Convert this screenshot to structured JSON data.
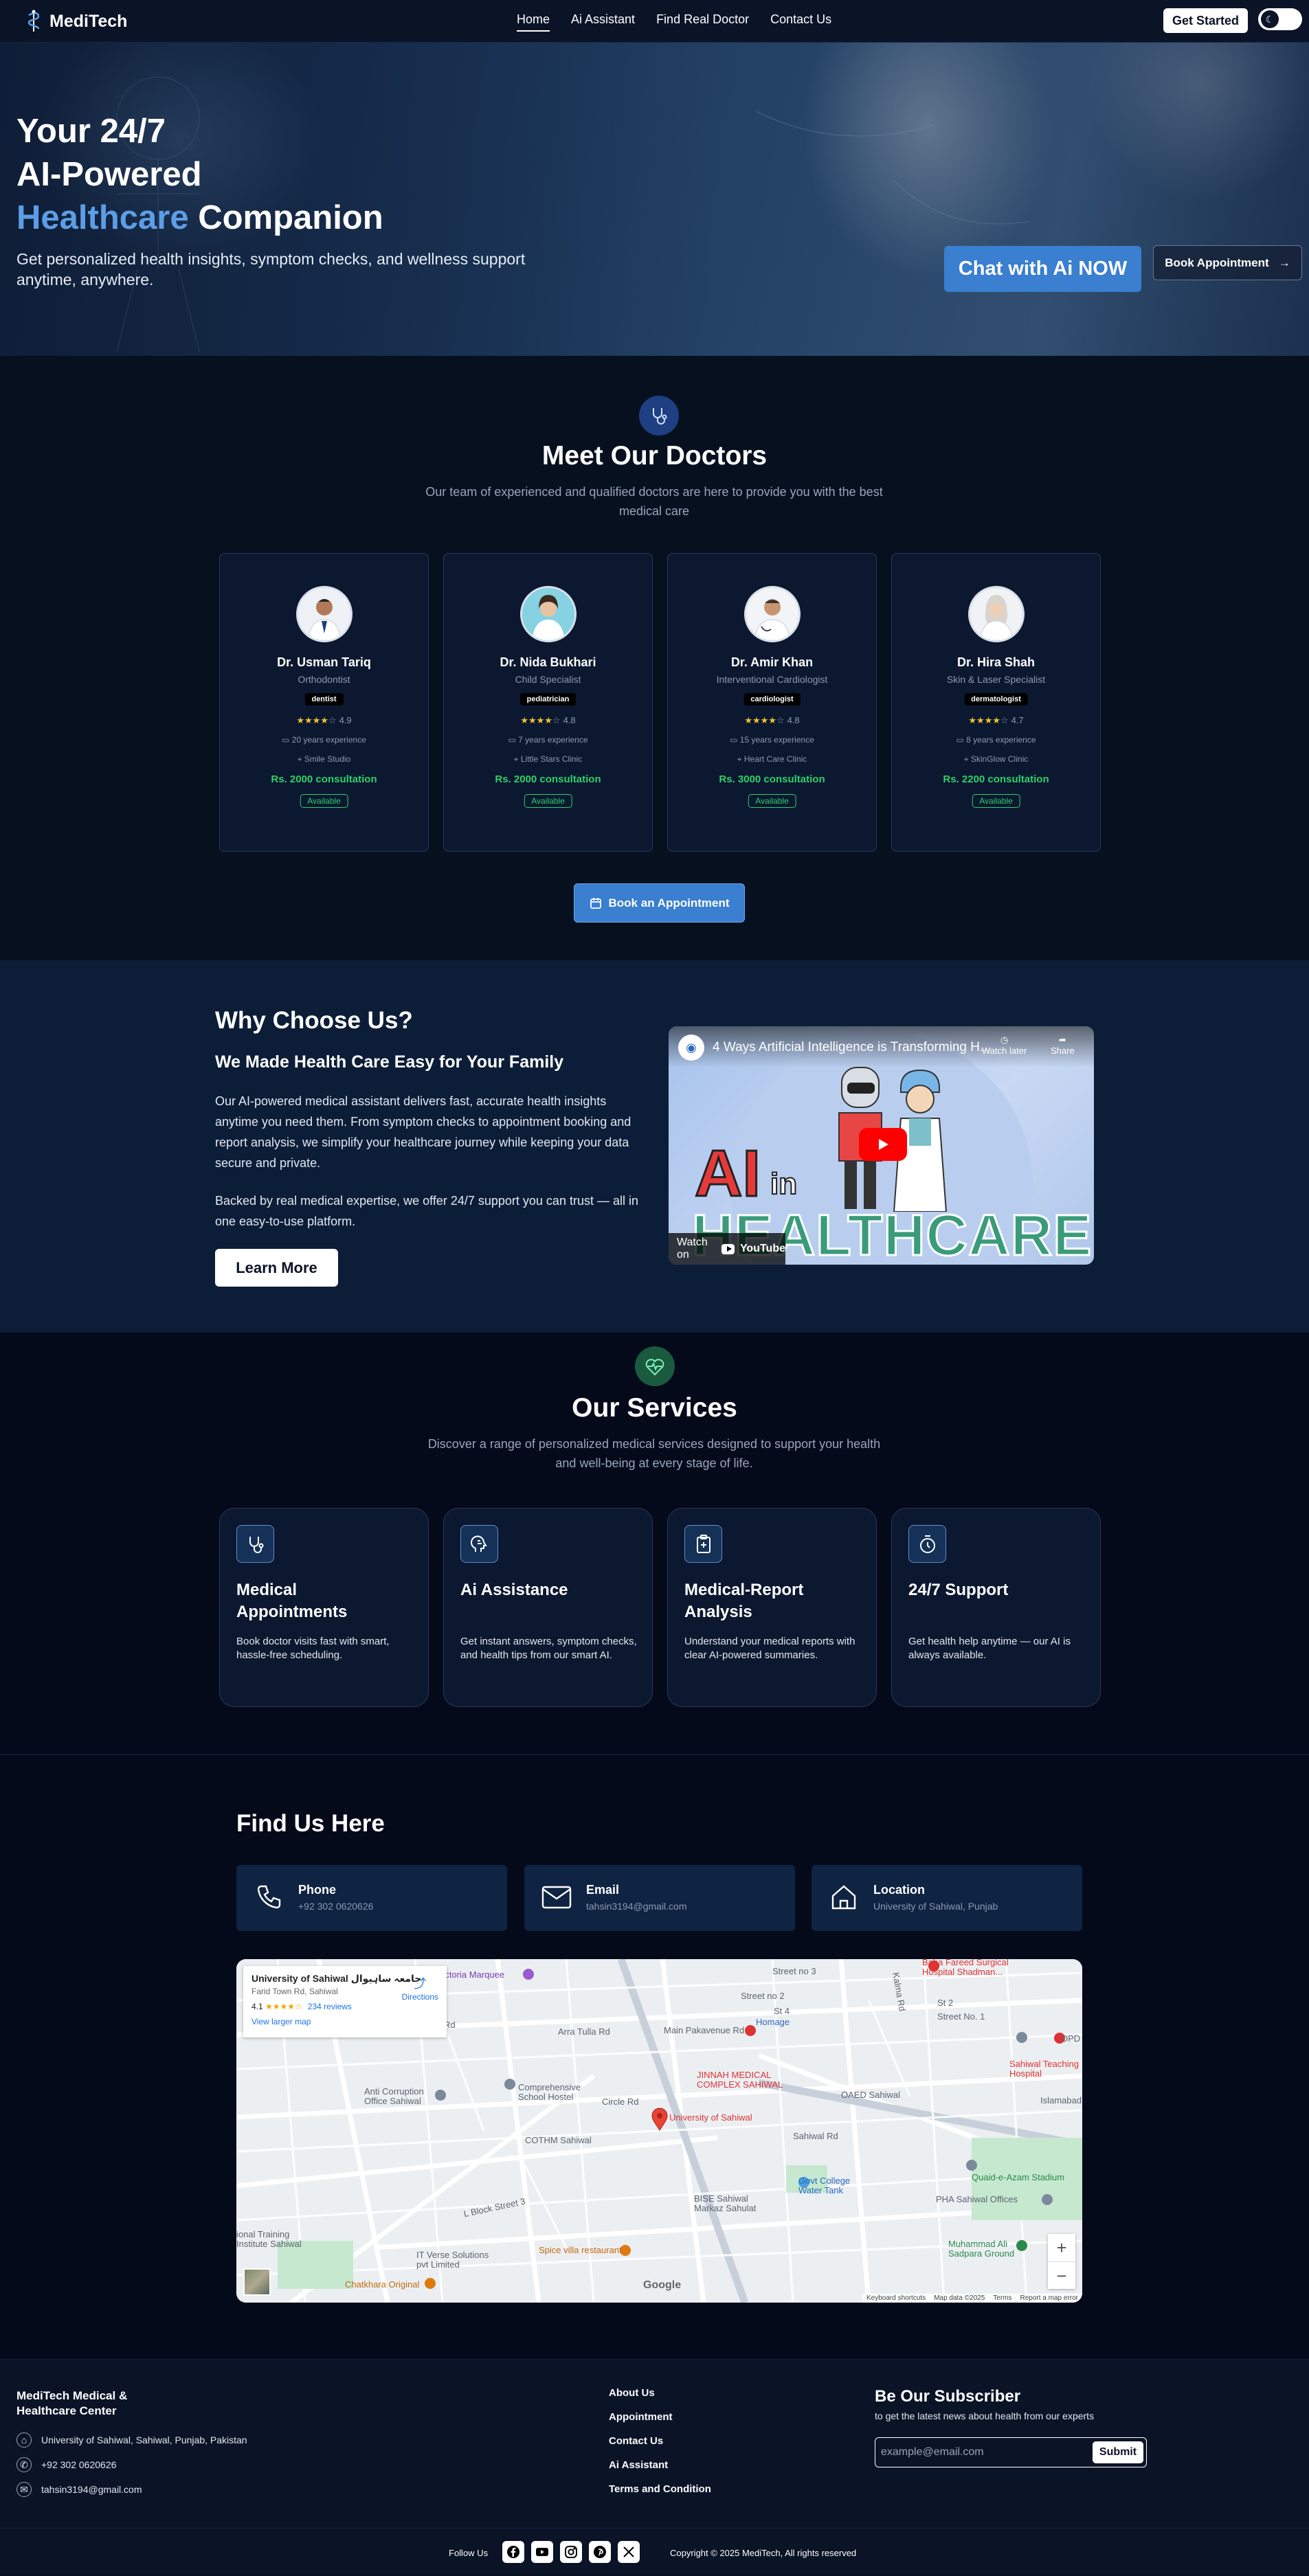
{
  "nav": {
    "brand": "MediTech",
    "links": [
      "Home",
      "Ai Assistant",
      "Find Real Doctor",
      "Contact Us"
    ],
    "get_started": "Get Started",
    "theme_icon": "moon-icon"
  },
  "hero": {
    "title_line1": "Your 24/7",
    "title_line2": "AI-Powered",
    "title_highlight": "Healthcare",
    "title_rest": " Companion",
    "subtitle": "Get personalized health insights, symptom checks, and wellness support anytime, anywhere.",
    "chat_button": "Chat with Ai NOW",
    "book_button": "Book Appointment"
  },
  "doctors": {
    "title": "Meet Our Doctors",
    "description": "Our team of experienced and qualified doctors are here to provide you with the best medical care",
    "icon": "stethoscope-icon",
    "list": [
      {
        "name": "Dr. Usman Tariq",
        "specialty": "Orthodontist",
        "tag": "dentist",
        "rating": "4.9",
        "stars": 4,
        "experience": "20 years experience",
        "clinic": "Smile Studio",
        "fee": "Rs. 2000 consultation",
        "status": "Available"
      },
      {
        "name": "Dr. Nida Bukhari",
        "specialty": "Child Specialist",
        "tag": "pediatrician",
        "rating": "4.8",
        "stars": 4,
        "experience": "7 years experience",
        "clinic": "Little Stars Clinic",
        "fee": "Rs. 2000 consultation",
        "status": "Available"
      },
      {
        "name": "Dr. Amir Khan",
        "specialty": "Interventional Cardiologist",
        "tag": "cardiologist",
        "rating": "4.8",
        "stars": 4,
        "experience": "15 years experience",
        "clinic": "Heart Care Clinic",
        "fee": "Rs. 3000 consultation",
        "status": "Available"
      },
      {
        "name": "Dr. Hira Shah",
        "specialty": "Skin & Laser Specialist",
        "tag": "dermatologist",
        "rating": "4.7",
        "stars": 4,
        "experience": "8 years experience",
        "clinic": "SkinGlow Clinic",
        "fee": "Rs. 2200 consultation",
        "status": "Available"
      }
    ],
    "appointment_button": "Book an Appointment"
  },
  "why": {
    "title": "Why Choose Us?",
    "subtitle": "We Made Health Care Easy for Your Family",
    "p1": "Our AI-powered medical assistant delivers fast, accurate health insights anytime you need them. From symptom checks to appointment booking and report analysis, we simplify your healthcare journey while keeping your data secure and private.",
    "p2": "Backed by real medical expertise, we offer 24/7 support you can trust — all in one easy-to-use platform.",
    "learn_more": "Learn More",
    "video": {
      "title": "4 Ways Artificial Intelligence is Transforming H...",
      "watch_later": "Watch later",
      "share": "Share",
      "watch_on": "Watch on",
      "youtube": "YouTube",
      "thumb_ai": "AI",
      "thumb_in": "in",
      "thumb_hc": "HEALTHCARE"
    }
  },
  "services": {
    "title": "Our Services",
    "description": "Discover a range of personalized medical services designed to support your health and well-being at every stage of life.",
    "icon": "heart-pulse-icon",
    "list": [
      {
        "title": "Medical Appointments",
        "desc": "Book doctor visits fast with smart, hassle-free scheduling.",
        "icon": "stethoscope-icon"
      },
      {
        "title": "Ai Assistance",
        "desc": "Get instant answers, symptom checks, and health tips from our smart AI.",
        "icon": "ai-brain-icon"
      },
      {
        "title": "Medical-Report Analysis",
        "desc": "Understand your medical reports with clear AI-powered summaries.",
        "icon": "clipboard-plus-icon"
      },
      {
        "title": "24/7 Support",
        "desc": "Get health help anytime — our AI is always available.",
        "icon": "clock-icon"
      }
    ]
  },
  "find": {
    "title": "Find Us Here",
    "contacts": [
      {
        "label": "Phone",
        "value": "+92 302 0620626",
        "icon": "phone-icon"
      },
      {
        "label": "Email",
        "value": "tahsin3194@gmail.com",
        "icon": "mail-icon"
      },
      {
        "label": "Location",
        "value": "University of Sahiwal, Punjab",
        "icon": "home-icon"
      }
    ],
    "map": {
      "place_name": "University of Sahiwal جامعہ ساہیوال",
      "address": "Farid Town Rd, Sahiwal",
      "rating": "4.1",
      "reviews": "234 reviews",
      "directions": "Directions",
      "larger_map": "View larger map",
      "pin_label": "University of Sahiwal",
      "keyboard": "Keyboard shortcuts",
      "map_data": "Map data ©2025",
      "terms": "Terms",
      "report": "Report a map error",
      "logo": "Google",
      "labels": [
        "Victoria Marquee",
        "Arra Tulla Rd",
        "Main Pakavenue Rd",
        "Street no 3",
        "Street no 2",
        "St 4",
        "Homage",
        "Baba Fareed Surgical Hospital Shadman...",
        "St 2",
        "Street No. 1",
        "OPD",
        "Sahiwal Teaching Hospital",
        "Islamabad Ce",
        "JINNAH MEDICAL COMPLEX SAHIWAL",
        "OAED Sahiwal",
        "Anti Corruption Office Sahiwal",
        "Comprehensive School Hostel",
        "Circle Rd",
        "COTHM Sahiwal",
        "Sahiwal Rd",
        "Quaid-e-Azam Stadium",
        "Govt College Water Tank",
        "PHA Sahiwal Offices",
        "BISE Sahiwal Markaz Sahulat",
        "L Block Street 3",
        "Muhammad Ali Sadpara Ground",
        "Spice villa restaurant",
        "IT Verse Solutions pvt Limited",
        "Chatkhara Original",
        "ional Training Institute Sahiwal",
        "Kalma Rd",
        "Iran Rd"
      ]
    }
  },
  "footer": {
    "name": "MediTech Medical & Healthcare Center",
    "address": "University of Sahiwal, Sahiwal, Punjab, Pakistan",
    "phone": "+92 302 0620626",
    "email": "tahsin3194@gmail.com",
    "links": [
      "About Us",
      "Appointment",
      "Contact Us",
      "Ai Assistant",
      "Terms and Condition"
    ],
    "subscribe_title": "Be Our Subscriber",
    "subscribe_desc": "to get the latest news about health from our experts",
    "email_placeholder": "example@email.com",
    "submit": "Submit",
    "follow": "Follow Us",
    "socials": [
      "facebook-icon",
      "youtube-icon",
      "instagram-icon",
      "pinterest-icon",
      "x-icon"
    ],
    "copyright": "Copyright © 2025 MediTech, All rights reserved"
  }
}
